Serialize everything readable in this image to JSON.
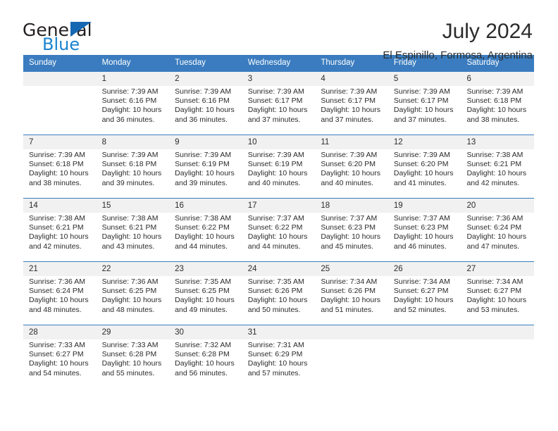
{
  "brand": {
    "word_general": "General",
    "word_blue": "Blue",
    "triangle_color": "#1668b3",
    "blue_text_color": "#1b84d0"
  },
  "header": {
    "title": "July 2024",
    "location": "El Espinillo, Formosa, Argentina",
    "accent_color": "#3a7cbf",
    "daynum_band_color": "#f1f1f1"
  },
  "weekday_headers": [
    "Sunday",
    "Monday",
    "Tuesday",
    "Wednesday",
    "Thursday",
    "Friday",
    "Saturday"
  ],
  "weeks": [
    [
      {
        "day": "",
        "empty": true
      },
      {
        "day": "1",
        "sunrise": "Sunrise: 7:39 AM",
        "sunset": "Sunset: 6:16 PM",
        "daylight1": "Daylight: 10 hours",
        "daylight2": "and 36 minutes."
      },
      {
        "day": "2",
        "sunrise": "Sunrise: 7:39 AM",
        "sunset": "Sunset: 6:16 PM",
        "daylight1": "Daylight: 10 hours",
        "daylight2": "and 36 minutes."
      },
      {
        "day": "3",
        "sunrise": "Sunrise: 7:39 AM",
        "sunset": "Sunset: 6:17 PM",
        "daylight1": "Daylight: 10 hours",
        "daylight2": "and 37 minutes."
      },
      {
        "day": "4",
        "sunrise": "Sunrise: 7:39 AM",
        "sunset": "Sunset: 6:17 PM",
        "daylight1": "Daylight: 10 hours",
        "daylight2": "and 37 minutes."
      },
      {
        "day": "5",
        "sunrise": "Sunrise: 7:39 AM",
        "sunset": "Sunset: 6:17 PM",
        "daylight1": "Daylight: 10 hours",
        "daylight2": "and 37 minutes."
      },
      {
        "day": "6",
        "sunrise": "Sunrise: 7:39 AM",
        "sunset": "Sunset: 6:18 PM",
        "daylight1": "Daylight: 10 hours",
        "daylight2": "and 38 minutes."
      }
    ],
    [
      {
        "day": "7",
        "sunrise": "Sunrise: 7:39 AM",
        "sunset": "Sunset: 6:18 PM",
        "daylight1": "Daylight: 10 hours",
        "daylight2": "and 38 minutes."
      },
      {
        "day": "8",
        "sunrise": "Sunrise: 7:39 AM",
        "sunset": "Sunset: 6:18 PM",
        "daylight1": "Daylight: 10 hours",
        "daylight2": "and 39 minutes."
      },
      {
        "day": "9",
        "sunrise": "Sunrise: 7:39 AM",
        "sunset": "Sunset: 6:19 PM",
        "daylight1": "Daylight: 10 hours",
        "daylight2": "and 39 minutes."
      },
      {
        "day": "10",
        "sunrise": "Sunrise: 7:39 AM",
        "sunset": "Sunset: 6:19 PM",
        "daylight1": "Daylight: 10 hours",
        "daylight2": "and 40 minutes."
      },
      {
        "day": "11",
        "sunrise": "Sunrise: 7:39 AM",
        "sunset": "Sunset: 6:20 PM",
        "daylight1": "Daylight: 10 hours",
        "daylight2": "and 40 minutes."
      },
      {
        "day": "12",
        "sunrise": "Sunrise: 7:39 AM",
        "sunset": "Sunset: 6:20 PM",
        "daylight1": "Daylight: 10 hours",
        "daylight2": "and 41 minutes."
      },
      {
        "day": "13",
        "sunrise": "Sunrise: 7:38 AM",
        "sunset": "Sunset: 6:21 PM",
        "daylight1": "Daylight: 10 hours",
        "daylight2": "and 42 minutes."
      }
    ],
    [
      {
        "day": "14",
        "sunrise": "Sunrise: 7:38 AM",
        "sunset": "Sunset: 6:21 PM",
        "daylight1": "Daylight: 10 hours",
        "daylight2": "and 42 minutes."
      },
      {
        "day": "15",
        "sunrise": "Sunrise: 7:38 AM",
        "sunset": "Sunset: 6:21 PM",
        "daylight1": "Daylight: 10 hours",
        "daylight2": "and 43 minutes."
      },
      {
        "day": "16",
        "sunrise": "Sunrise: 7:38 AM",
        "sunset": "Sunset: 6:22 PM",
        "daylight1": "Daylight: 10 hours",
        "daylight2": "and 44 minutes."
      },
      {
        "day": "17",
        "sunrise": "Sunrise: 7:37 AM",
        "sunset": "Sunset: 6:22 PM",
        "daylight1": "Daylight: 10 hours",
        "daylight2": "and 44 minutes."
      },
      {
        "day": "18",
        "sunrise": "Sunrise: 7:37 AM",
        "sunset": "Sunset: 6:23 PM",
        "daylight1": "Daylight: 10 hours",
        "daylight2": "and 45 minutes."
      },
      {
        "day": "19",
        "sunrise": "Sunrise: 7:37 AM",
        "sunset": "Sunset: 6:23 PM",
        "daylight1": "Daylight: 10 hours",
        "daylight2": "and 46 minutes."
      },
      {
        "day": "20",
        "sunrise": "Sunrise: 7:36 AM",
        "sunset": "Sunset: 6:24 PM",
        "daylight1": "Daylight: 10 hours",
        "daylight2": "and 47 minutes."
      }
    ],
    [
      {
        "day": "21",
        "sunrise": "Sunrise: 7:36 AM",
        "sunset": "Sunset: 6:24 PM",
        "daylight1": "Daylight: 10 hours",
        "daylight2": "and 48 minutes."
      },
      {
        "day": "22",
        "sunrise": "Sunrise: 7:36 AM",
        "sunset": "Sunset: 6:25 PM",
        "daylight1": "Daylight: 10 hours",
        "daylight2": "and 48 minutes."
      },
      {
        "day": "23",
        "sunrise": "Sunrise: 7:35 AM",
        "sunset": "Sunset: 6:25 PM",
        "daylight1": "Daylight: 10 hours",
        "daylight2": "and 49 minutes."
      },
      {
        "day": "24",
        "sunrise": "Sunrise: 7:35 AM",
        "sunset": "Sunset: 6:26 PM",
        "daylight1": "Daylight: 10 hours",
        "daylight2": "and 50 minutes."
      },
      {
        "day": "25",
        "sunrise": "Sunrise: 7:34 AM",
        "sunset": "Sunset: 6:26 PM",
        "daylight1": "Daylight: 10 hours",
        "daylight2": "and 51 minutes."
      },
      {
        "day": "26",
        "sunrise": "Sunrise: 7:34 AM",
        "sunset": "Sunset: 6:27 PM",
        "daylight1": "Daylight: 10 hours",
        "daylight2": "and 52 minutes."
      },
      {
        "day": "27",
        "sunrise": "Sunrise: 7:34 AM",
        "sunset": "Sunset: 6:27 PM",
        "daylight1": "Daylight: 10 hours",
        "daylight2": "and 53 minutes."
      }
    ],
    [
      {
        "day": "28",
        "sunrise": "Sunrise: 7:33 AM",
        "sunset": "Sunset: 6:27 PM",
        "daylight1": "Daylight: 10 hours",
        "daylight2": "and 54 minutes."
      },
      {
        "day": "29",
        "sunrise": "Sunrise: 7:33 AM",
        "sunset": "Sunset: 6:28 PM",
        "daylight1": "Daylight: 10 hours",
        "daylight2": "and 55 minutes."
      },
      {
        "day": "30",
        "sunrise": "Sunrise: 7:32 AM",
        "sunset": "Sunset: 6:28 PM",
        "daylight1": "Daylight: 10 hours",
        "daylight2": "and 56 minutes."
      },
      {
        "day": "31",
        "sunrise": "Sunrise: 7:31 AM",
        "sunset": "Sunset: 6:29 PM",
        "daylight1": "Daylight: 10 hours",
        "daylight2": "and 57 minutes."
      },
      {
        "day": "",
        "empty": true
      },
      {
        "day": "",
        "empty": true
      },
      {
        "day": "",
        "empty": true
      }
    ]
  ]
}
